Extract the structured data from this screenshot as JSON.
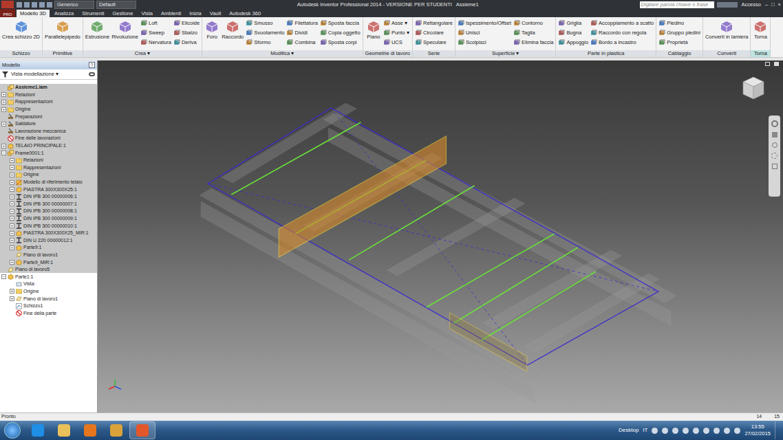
{
  "window": {
    "title": "Autodesk Inventor Professional 2014 - VERSIONE PER STUDENTI   Assieme1",
    "app_button": "PRO",
    "controls": [
      "–",
      "□",
      "×"
    ]
  },
  "quick_access": [
    {
      "label": "Generico"
    },
    {
      "label": "Default"
    }
  ],
  "search": {
    "placeholder": "Digitare parola chiave o frase"
  },
  "account": {
    "label": "Accesso"
  },
  "tabs": [
    {
      "label": "Modello 3D",
      "selected": true
    },
    {
      "label": "Analizza",
      "selected": false
    },
    {
      "label": "Strumenti",
      "selected": false
    },
    {
      "label": "Gestione",
      "selected": false
    },
    {
      "label": "Vista",
      "selected": false
    },
    {
      "label": "Ambienti",
      "selected": false
    },
    {
      "label": "Inizia",
      "selected": false
    },
    {
      "label": "Vault",
      "selected": false
    },
    {
      "label": "Autodesk 360",
      "selected": false
    }
  ],
  "ribbon": {
    "groups": [
      {
        "label": "Schizzo",
        "highlighted": false,
        "items": [
          {
            "label": "Crea schizzo 2D",
            "kind": "large"
          }
        ]
      },
      {
        "label": "Primitive",
        "highlighted": false,
        "items": [
          {
            "label": "Parallelepipedo",
            "kind": "large"
          }
        ]
      },
      {
        "label": "Crea ▾",
        "highlighted": false,
        "items": [
          {
            "label": "Estrusione",
            "kind": "large"
          },
          {
            "label": "Rivoluzione",
            "kind": "large"
          },
          {
            "label": "Loft",
            "kind": "small"
          },
          {
            "label": "Sweep",
            "kind": "small"
          },
          {
            "label": "Nervatura",
            "kind": "small"
          },
          {
            "label": "Elicoide",
            "kind": "small"
          },
          {
            "label": "Sbalzo",
            "kind": "small"
          },
          {
            "label": "Deriva",
            "kind": "small"
          }
        ]
      },
      {
        "label": "Modifica ▾",
        "highlighted": false,
        "items": [
          {
            "label": "Foro",
            "kind": "large"
          },
          {
            "label": "Raccordo",
            "kind": "large"
          },
          {
            "label": "Smusso",
            "kind": "small"
          },
          {
            "label": "Svuotamento",
            "kind": "small"
          },
          {
            "label": "Sformo",
            "kind": "small"
          },
          {
            "label": "Filettatura",
            "kind": "small"
          },
          {
            "label": "Dividi",
            "kind": "small"
          },
          {
            "label": "Combina",
            "kind": "small"
          },
          {
            "label": "Sposta faccia",
            "kind": "small"
          },
          {
            "label": "Copia oggetto",
            "kind": "small"
          },
          {
            "label": "Sposta corpi",
            "kind": "small"
          }
        ]
      },
      {
        "label": "Geometrie di lavoro",
        "highlighted": false,
        "items": [
          {
            "label": "Piano",
            "kind": "large"
          },
          {
            "label": "Asse ▾",
            "kind": "small"
          },
          {
            "label": "Punto ▾",
            "kind": "small"
          },
          {
            "label": "UCS",
            "kind": "small"
          }
        ]
      },
      {
        "label": "Serie",
        "highlighted": false,
        "items": [
          {
            "label": "Rettangolare",
            "kind": "small"
          },
          {
            "label": "Circolare",
            "kind": "small"
          },
          {
            "label": "Speculare",
            "kind": "small"
          }
        ]
      },
      {
        "label": "Superficie ▾",
        "highlighted": false,
        "items": [
          {
            "label": "Ispessimento/Offset",
            "kind": "small"
          },
          {
            "label": "Unisci",
            "kind": "small"
          },
          {
            "label": "Scolpisci",
            "kind": "small"
          },
          {
            "label": "Contorno",
            "kind": "small"
          },
          {
            "label": "Taglia",
            "kind": "small"
          },
          {
            "label": "Elimina faccia",
            "kind": "small"
          }
        ]
      },
      {
        "label": "Parte in plastica",
        "highlighted": false,
        "items": [
          {
            "label": "Griglia",
            "kind": "small"
          },
          {
            "label": "Bugna",
            "kind": "small"
          },
          {
            "label": "Appoggio",
            "kind": "small"
          },
          {
            "label": "Accoppiamento a scatto",
            "kind": "small"
          },
          {
            "label": "Raccordo con regola",
            "kind": "small"
          },
          {
            "label": "Bordo a incastro",
            "kind": "small"
          }
        ]
      },
      {
        "label": "Cablaggio",
        "highlighted": false,
        "items": [
          {
            "label": "Piedino",
            "kind": "small"
          },
          {
            "label": "Gruppo piedini",
            "kind": "small"
          },
          {
            "label": "Proprietà",
            "kind": "small"
          }
        ]
      },
      {
        "label": "Converti",
        "highlighted": false,
        "items": [
          {
            "label": "Converti in lamiera",
            "kind": "large"
          }
        ]
      },
      {
        "label": "Torna",
        "highlighted": true,
        "items": [
          {
            "label": "Torna",
            "kind": "large"
          }
        ]
      }
    ]
  },
  "browser": {
    "title": "Modello",
    "help": "?",
    "view": "Vista modellazione ▾",
    "items": [
      {
        "label": "Assieme1.iam",
        "level": 0,
        "expander": "",
        "icon": "assembly",
        "bold": true,
        "dimmed": true
      },
      {
        "label": "Relazioni",
        "level": 0,
        "expander": "+",
        "icon": "folder",
        "bold": false,
        "dimmed": true
      },
      {
        "label": "Rappresentazioni",
        "level": 0,
        "expander": "+",
        "icon": "folder",
        "bold": false,
        "dimmed": true
      },
      {
        "label": "Origine",
        "level": 0,
        "expander": "+",
        "icon": "folder",
        "bold": false,
        "dimmed": true
      },
      {
        "label": "Preparazioni",
        "level": 0,
        "expander": "",
        "icon": "prep",
        "bold": false,
        "dimmed": true
      },
      {
        "label": "Saldature",
        "level": 0,
        "expander": "+",
        "icon": "weld",
        "bold": false,
        "dimmed": true
      },
      {
        "label": "Lavorazione meccanica",
        "level": 0,
        "expander": "",
        "icon": "prep",
        "bold": false,
        "dimmed": true
      },
      {
        "label": "Fine delle lavorazioni",
        "level": 0,
        "expander": "",
        "icon": "stop",
        "bold": false,
        "dimmed": true
      },
      {
        "label": "TELAIO PRINCIPALE:1",
        "level": 0,
        "expander": "+",
        "icon": "part",
        "bold": false,
        "dimmed": true
      },
      {
        "label": "Frame0001:1",
        "level": 0,
        "expander": "−",
        "icon": "assembly",
        "bold": false,
        "dimmed": true
      },
      {
        "label": "Relazioni",
        "level": 1,
        "expander": "+",
        "icon": "folder",
        "bold": false,
        "dimmed": true
      },
      {
        "label": "Rappresentazioni",
        "level": 1,
        "expander": "+",
        "icon": "folder",
        "bold": false,
        "dimmed": true
      },
      {
        "label": "Origine",
        "level": 1,
        "expander": "+",
        "icon": "folder",
        "bold": false,
        "dimmed": true
      },
      {
        "label": "Modello di riferimento telaio",
        "level": 1,
        "expander": "+",
        "icon": "reference",
        "bold": false,
        "dimmed": true
      },
      {
        "label": "PIASTRA 300X300X25:1",
        "level": 1,
        "expander": "+",
        "icon": "part",
        "bold": false,
        "dimmed": true
      },
      {
        "label": "DIN IPB 300 00000006:1",
        "level": 1,
        "expander": "+",
        "icon": "beam",
        "bold": false,
        "dimmed": true
      },
      {
        "label": "DIN IPB 300 00000007:1",
        "level": 1,
        "expander": "+",
        "icon": "beam",
        "bold": false,
        "dimmed": true
      },
      {
        "label": "DIN IPB 300 00000008:1",
        "level": 1,
        "expander": "+",
        "icon": "beam",
        "bold": false,
        "dimmed": true
      },
      {
        "label": "DIN IPB 300 00000009:1",
        "level": 1,
        "expander": "+",
        "icon": "beam",
        "bold": false,
        "dimmed": true
      },
      {
        "label": "DIN IPB 300 00000010:1",
        "level": 1,
        "expander": "+",
        "icon": "beam",
        "bold": false,
        "dimmed": true
      },
      {
        "label": "PIASTRA 300X300X25_MIR:1",
        "level": 1,
        "expander": "+",
        "icon": "part",
        "bold": false,
        "dimmed": true
      },
      {
        "label": "DIN U 220 00000012:1",
        "level": 1,
        "expander": "+",
        "icon": "beam",
        "bold": false,
        "dimmed": true
      },
      {
        "label": "Parte9:1",
        "level": 1,
        "expander": "+",
        "icon": "part",
        "bold": false,
        "dimmed": true
      },
      {
        "label": "Piano di lavoro1",
        "level": 1,
        "expander": "",
        "icon": "plane",
        "bold": false,
        "dimmed": true
      },
      {
        "label": "Parte9_MIR:1",
        "level": 1,
        "expander": "+",
        "icon": "part",
        "bold": false,
        "dimmed": true
      },
      {
        "label": "Piano di lavoro5",
        "level": 0,
        "expander": "",
        "icon": "plane",
        "bold": false,
        "dimmed": true
      },
      {
        "label": "Parte1:1",
        "level": 0,
        "expander": "−",
        "icon": "part",
        "bold": false,
        "dimmed": false
      },
      {
        "label": "Vista:",
        "level": 1,
        "expander": "",
        "icon": "view",
        "bold": false,
        "dimmed": false
      },
      {
        "label": "Origine",
        "level": 1,
        "expander": "+",
        "icon": "folder",
        "bold": false,
        "dimmed": false
      },
      {
        "label": "Piano di lavoro1",
        "level": 1,
        "expander": "+",
        "icon": "plane",
        "bold": false,
        "dimmed": false
      },
      {
        "label": "Schizzo1",
        "level": 1,
        "expander": "",
        "icon": "sketch",
        "bold": false,
        "dimmed": false
      },
      {
        "label": "Fine della parte",
        "level": 1,
        "expander": "",
        "icon": "stop",
        "bold": false,
        "dimmed": false
      }
    ]
  },
  "status_bar": {
    "text": "Pronto",
    "numbers": [
      "14",
      "15"
    ]
  },
  "taskbar": {
    "desktop": "Desktop",
    "language": "IT",
    "time": "13:55",
    "date": "27/02/2015"
  }
}
